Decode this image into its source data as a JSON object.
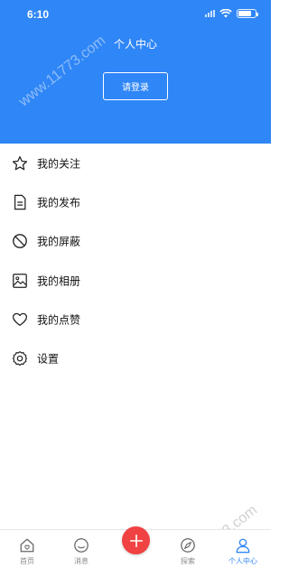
{
  "status_bar": {
    "time": "6:10",
    "battery_level": 0.8
  },
  "header": {
    "title": "个人中心",
    "login_label": "请登录"
  },
  "menu": [
    {
      "icon": "star-icon",
      "label": "我的关注"
    },
    {
      "icon": "document-icon",
      "label": "我的发布"
    },
    {
      "icon": "block-icon",
      "label": "我的屏蔽"
    },
    {
      "icon": "image-icon",
      "label": "我的相册"
    },
    {
      "icon": "heart-icon",
      "label": "我的点赞"
    },
    {
      "icon": "gear-icon",
      "label": "设置"
    }
  ],
  "tabbar": {
    "items": [
      {
        "icon": "home-icon",
        "label": "首页",
        "active": false
      },
      {
        "icon": "message-icon",
        "label": "消息",
        "active": false
      },
      {
        "icon": "compass-icon",
        "label": "探索",
        "active": false
      },
      {
        "icon": "person-icon",
        "label": "个人中心",
        "active": true
      }
    ],
    "fab_icon": "plus-icon"
  },
  "watermark": "www.11773.com",
  "colors": {
    "primary": "#2f86f6",
    "fab": "#f04242",
    "text": "#111111",
    "tab_inactive": "#888888"
  }
}
